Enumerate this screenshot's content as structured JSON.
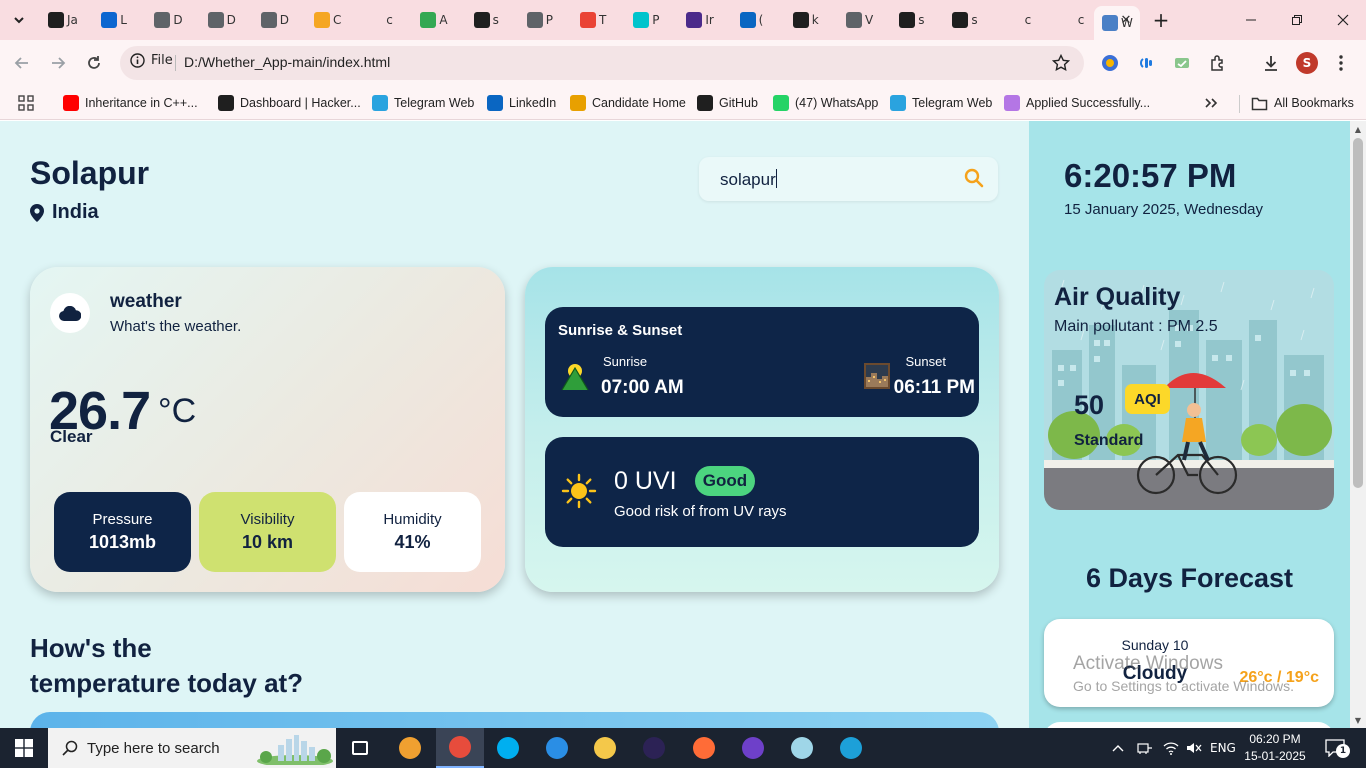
{
  "browser": {
    "tabs": [
      {
        "label": "Ja",
        "icon": "openai-icon",
        "color": "#1f1f1f"
      },
      {
        "label": "L",
        "icon": "salesforce-icon",
        "color": "#0d66d0"
      },
      {
        "label": "D",
        "icon": "globe-icon",
        "color": "#5f6368"
      },
      {
        "label": "D",
        "icon": "globe-icon",
        "color": "#5f6368"
      },
      {
        "label": "D",
        "icon": "globe-icon",
        "color": "#5f6368"
      },
      {
        "label": "C",
        "icon": "jd-icon",
        "color": "#f5a623"
      },
      {
        "label": "c",
        "icon": "blank-icon",
        "color": "#f9dde1"
      },
      {
        "label": "A",
        "icon": "maps-icon",
        "color": "#34a853"
      },
      {
        "label": "s",
        "icon": "github-icon",
        "color": "#1f1f1f"
      },
      {
        "label": "P",
        "icon": "globe-icon",
        "color": "#5f6368"
      },
      {
        "label": "T",
        "icon": "gmail-icon",
        "color": "#ea4335"
      },
      {
        "label": "P",
        "icon": "canva-icon",
        "color": "#00c4cc"
      },
      {
        "label": "Ir",
        "icon": "list-icon",
        "color": "#4b2a8a"
      },
      {
        "label": "(",
        "icon": "linkedin-icon",
        "color": "#0a66c2"
      },
      {
        "label": "k",
        "icon": "github-icon",
        "color": "#1f1f1f"
      },
      {
        "label": "V",
        "icon": "globe-icon",
        "color": "#5f6368"
      },
      {
        "label": "s",
        "icon": "github-icon",
        "color": "#1f1f1f"
      },
      {
        "label": "s",
        "icon": "github-icon",
        "color": "#1f1f1f"
      },
      {
        "label": "c",
        "icon": "blank-icon",
        "color": "#f9dde1"
      },
      {
        "label": "c",
        "icon": "blank-icon",
        "color": "#f9dde1"
      }
    ],
    "active_tab": {
      "label": "W",
      "close": "✕"
    },
    "new_tab": "+",
    "address": {
      "scheme": "File",
      "url": "D:/Whether_App-main/index.html"
    },
    "profile_initial": "S",
    "bookmarks": [
      {
        "label": "Inheritance in C++...",
        "icon": "youtube-icon",
        "color": "#ff0000"
      },
      {
        "label": "Dashboard | Hacker...",
        "icon": "hackerrank-icon",
        "color": "#1f1f1f"
      },
      {
        "label": "Telegram Web",
        "icon": "telegram-icon",
        "color": "#2aa3df"
      },
      {
        "label": "LinkedIn",
        "icon": "linkedin-icon",
        "color": "#0a66c2"
      },
      {
        "label": "Candidate Home",
        "icon": "candidate-icon",
        "color": "#e8a000"
      },
      {
        "label": "GitHub",
        "icon": "github-icon",
        "color": "#1f1f1f"
      },
      {
        "label": "(47) WhatsApp",
        "icon": "whatsapp-icon",
        "color": "#25d366"
      },
      {
        "label": "Telegram Web",
        "icon": "telegram-icon",
        "color": "#2aa3df"
      },
      {
        "label": "Applied Successfully...",
        "icon": "applied-icon",
        "color": "#b476e5"
      }
    ],
    "all_bookmarks": "All Bookmarks"
  },
  "app": {
    "city": "Solapur",
    "country": "India",
    "search": {
      "value": "solapur"
    },
    "weather_card": {
      "title": "weather",
      "subtitle": "What's the weather.",
      "temperature": "26.7",
      "unit": "°C",
      "condition": "Clear",
      "stats": [
        {
          "label": "Pressure",
          "value": "1013mb",
          "bg": "#0e2548",
          "fg": "#ffffff"
        },
        {
          "label": "Visibility",
          "value": "10 km",
          "bg": "#cfe170",
          "fg": "#112240"
        },
        {
          "label": "Humidity",
          "value": "41%",
          "bg": "#ffffff",
          "fg": "#112240"
        }
      ]
    },
    "sun": {
      "title": "Sunrise & Sunset",
      "sunrise_label": "Sunrise",
      "sunrise_time": "07:00 AM",
      "sunset_label": "Sunset",
      "sunset_time": "06:11 PM"
    },
    "uv": {
      "value": "0 UVI",
      "badge": "Good",
      "description": "Good risk of from UV rays"
    },
    "hourly_heading": [
      "How's the",
      "temperature today at?"
    ],
    "time": "6:20:57 PM",
    "date": "15 January 2025, Wednesday",
    "air_quality": {
      "title": "Air Quality",
      "pollutant": "Main pollutant : PM 2.5",
      "aqi_value": "50",
      "aqi_label": "AQI",
      "level": "Standard"
    },
    "forecast": {
      "title": "6 Days Forecast",
      "day": "Sunday 10",
      "condition": "Cloudy",
      "temps": "26°c / 19°c"
    }
  },
  "windows_watermark": {
    "line1": "Activate Windows",
    "line2": "Go to Settings to activate Windows."
  },
  "taskbar": {
    "search_placeholder": "Type here to search",
    "apps": [
      "task-view-icon",
      "git-icon",
      "chrome-icon",
      "skype-icon",
      "vscode-icon",
      "file-explorer-icon",
      "eclipse-icon",
      "postman-icon",
      "github-desktop-icon",
      "notepad-icon",
      "edge-icon"
    ],
    "language": "ENG",
    "clock_time": "06:20 PM",
    "clock_date": "15-01-2025",
    "notification_count": "1"
  }
}
